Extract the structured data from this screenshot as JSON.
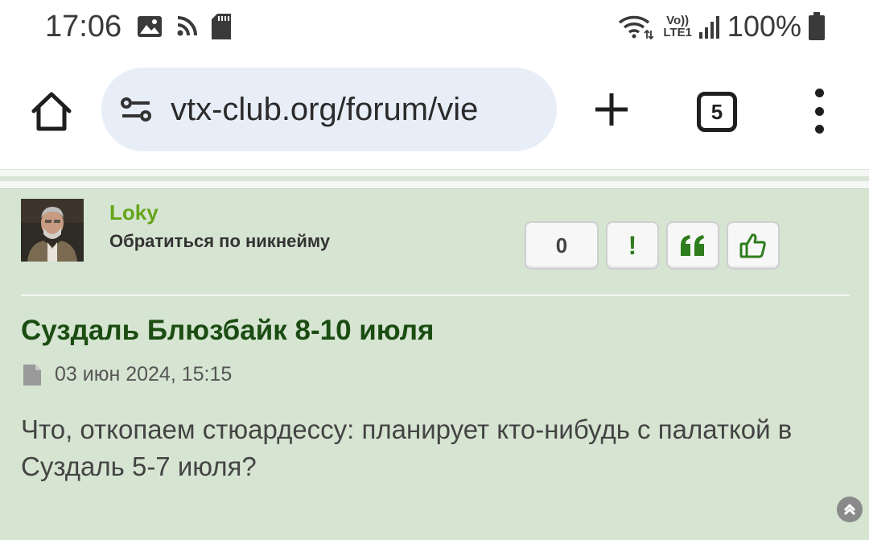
{
  "status_bar": {
    "time": "17:06",
    "battery_percent": "100%",
    "signal_label_top": "Vo))",
    "signal_label_bottom": "LTE1",
    "icons": [
      "image-icon",
      "nfc-icon",
      "sd-card-icon",
      "wifi-icon",
      "lte-icon",
      "signal-icon",
      "battery-icon"
    ]
  },
  "browser": {
    "url": "vtx-club.org/forum/vie",
    "tab_count": "5",
    "icons": [
      "home-icon",
      "site-settings-icon",
      "plus-icon",
      "tabs-icon",
      "more-vert-icon"
    ]
  },
  "post": {
    "username": "Loky",
    "mention_label": "Обратиться по никнейму",
    "reaction_count": "0",
    "report_label": "!",
    "title": "Суздаль Блюзбайк 8-10 июля",
    "date": "03 июн 2024, 15:15",
    "body": "Что, откопаем стюардессу: планирует кто-нибудь с палаткой в Суздаль 5-7 июля?"
  },
  "colors": {
    "post_bg": "#d6e4d2",
    "username": "#64a51a",
    "title": "#1b4d12",
    "url_pill": "#e8eef8",
    "button_icon": "#2e7d1e"
  }
}
